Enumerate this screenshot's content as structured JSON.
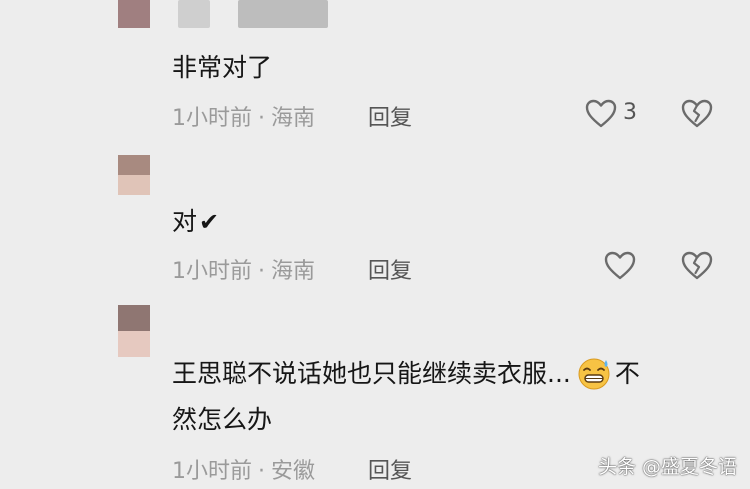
{
  "comments": [
    {
      "text": "非常对了",
      "time": "1小时前",
      "location": "海南",
      "reply": "回复",
      "likes": "3",
      "avatar_colors": [
        "#a07f80",
        "#a07f80"
      ]
    },
    {
      "text": "对",
      "check": "✔",
      "time": "1小时前",
      "location": "海南",
      "reply": "回复",
      "avatar_colors": [
        "#a88a80",
        "#e0c4b8"
      ]
    },
    {
      "text_line1_a": "王思聪不说话她也只能继续卖衣服...",
      "emoji": "grinning-sweat-emoji",
      "text_line1_b": "不",
      "text_line2": "然怎么办",
      "time": "1小时前",
      "location": "安徽",
      "reply": "回复",
      "avatar_colors": [
        "#8f7672",
        "#e6c9c0"
      ]
    }
  ],
  "meta_separator": "·",
  "watermark": "头条 @盛夏冬语",
  "colors": {
    "background": "#ededed",
    "text": "#161616",
    "meta": "#9a9a9a",
    "icon": "#6b6b6b"
  }
}
